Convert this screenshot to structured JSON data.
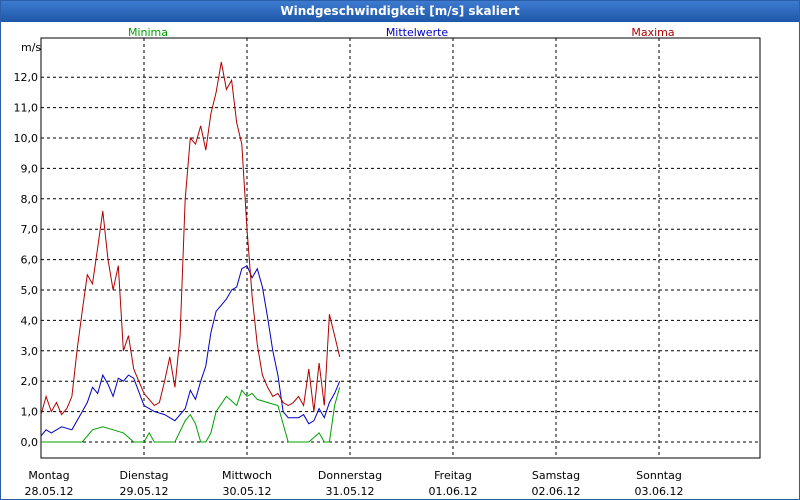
{
  "window": {
    "title": "Windgeschwindigkeit [m/s] skaliert"
  },
  "chart_data": {
    "type": "line",
    "title": "Windgeschwindigkeit [m/s] skaliert",
    "ylabel": "m/s",
    "xlabel": "",
    "ylim": [
      -0.5,
      13.0
    ],
    "yticks": [
      "0,0",
      "1,0",
      "2,0",
      "3,0",
      "4,0",
      "5,0",
      "6,0",
      "7,0",
      "8,0",
      "9,0",
      "10,0",
      "11,0",
      "12,0"
    ],
    "ytick_values": [
      0,
      1,
      2,
      3,
      4,
      5,
      6,
      7,
      8,
      9,
      10,
      11,
      12
    ],
    "x_days": [
      {
        "day": "Montag",
        "date": "28.05.12"
      },
      {
        "day": "Dienstag",
        "date": "29.05.12"
      },
      {
        "day": "Mittwoch",
        "date": "30.05.12"
      },
      {
        "day": "Donnerstag",
        "date": "31.05.12"
      },
      {
        "day": "Freitag",
        "date": "01.06.12"
      },
      {
        "day": "Samstag",
        "date": "02.06.12"
      },
      {
        "day": "Sonntag",
        "date": "03.06.12"
      }
    ],
    "x_unit": "days since Montag 28.05.12 00:00",
    "xlim": [
      0,
      7
    ],
    "grid": true,
    "legend_placement": "top",
    "series": [
      {
        "name": "Minima",
        "color": "#00a000",
        "x": [
          0.0,
          0.2,
          0.4,
          0.5,
          0.6,
          0.7,
          0.8,
          0.9,
          1.0,
          1.05,
          1.1,
          1.2,
          1.3,
          1.4,
          1.45,
          1.5,
          1.55,
          1.6,
          1.65,
          1.7,
          1.8,
          1.9,
          1.95,
          2.0,
          2.05,
          2.1,
          2.2,
          2.3,
          2.4,
          2.5,
          2.6,
          2.7,
          2.75,
          2.8,
          2.85,
          2.9
        ],
        "values": [
          0.0,
          0.0,
          0.0,
          0.4,
          0.5,
          0.4,
          0.3,
          0.0,
          0.0,
          0.3,
          0.0,
          0.0,
          0.0,
          0.7,
          0.9,
          0.6,
          0.0,
          0.0,
          0.3,
          1.0,
          1.5,
          1.2,
          1.7,
          1.5,
          1.6,
          1.4,
          1.3,
          1.2,
          0.0,
          0.0,
          0.0,
          0.3,
          0.0,
          0.0,
          1.2,
          1.8
        ]
      },
      {
        "name": "Mittelwerte",
        "color": "#0000c0",
        "x": [
          0.0,
          0.05,
          0.1,
          0.2,
          0.3,
          0.4,
          0.45,
          0.5,
          0.55,
          0.6,
          0.65,
          0.7,
          0.75,
          0.8,
          0.85,
          0.9,
          1.0,
          1.1,
          1.2,
          1.3,
          1.4,
          1.45,
          1.5,
          1.55,
          1.6,
          1.65,
          1.7,
          1.75,
          1.8,
          1.85,
          1.9,
          1.95,
          2.0,
          2.05,
          2.1,
          2.15,
          2.2,
          2.25,
          2.3,
          2.35,
          2.4,
          2.5,
          2.55,
          2.6,
          2.65,
          2.7,
          2.75,
          2.8,
          2.85,
          2.9
        ],
        "values": [
          0.2,
          0.4,
          0.3,
          0.5,
          0.4,
          1.0,
          1.3,
          1.8,
          1.6,
          2.2,
          1.9,
          1.5,
          2.1,
          2.0,
          2.2,
          2.1,
          1.2,
          1.0,
          0.9,
          0.7,
          1.1,
          1.7,
          1.4,
          2.0,
          2.5,
          3.6,
          4.3,
          4.5,
          4.7,
          5.0,
          5.1,
          5.7,
          5.8,
          5.4,
          5.7,
          5.1,
          4.1,
          3.0,
          2.2,
          1.0,
          0.8,
          0.8,
          0.9,
          0.6,
          0.7,
          1.1,
          0.8,
          1.3,
          1.6,
          2.0
        ]
      },
      {
        "name": "Maxima",
        "color": "#b00000",
        "x": [
          0.0,
          0.05,
          0.1,
          0.15,
          0.2,
          0.25,
          0.3,
          0.35,
          0.4,
          0.45,
          0.5,
          0.55,
          0.6,
          0.65,
          0.7,
          0.75,
          0.8,
          0.85,
          0.9,
          0.95,
          1.0,
          1.05,
          1.1,
          1.15,
          1.2,
          1.25,
          1.3,
          1.35,
          1.4,
          1.45,
          1.5,
          1.55,
          1.6,
          1.65,
          1.7,
          1.75,
          1.8,
          1.85,
          1.9,
          1.95,
          2.0,
          2.05,
          2.1,
          2.15,
          2.2,
          2.25,
          2.3,
          2.35,
          2.4,
          2.45,
          2.5,
          2.55,
          2.6,
          2.65,
          2.7,
          2.75,
          2.8,
          2.85,
          2.9
        ],
        "values": [
          0.9,
          1.5,
          1.0,
          1.3,
          0.9,
          1.1,
          1.5,
          3.0,
          4.3,
          5.5,
          5.2,
          6.4,
          7.6,
          6.0,
          5.0,
          5.8,
          3.0,
          3.5,
          2.4,
          2.0,
          1.6,
          1.4,
          1.2,
          1.3,
          2.0,
          2.8,
          1.8,
          3.5,
          8.0,
          10.0,
          9.8,
          10.4,
          9.6,
          10.8,
          11.5,
          12.5,
          11.6,
          11.9,
          10.5,
          9.8,
          7.0,
          4.8,
          3.2,
          2.2,
          1.8,
          1.5,
          1.6,
          1.3,
          1.2,
          1.3,
          1.5,
          1.2,
          2.4,
          1.0,
          2.6,
          1.2,
          4.2,
          3.5,
          2.8
        ]
      }
    ]
  }
}
